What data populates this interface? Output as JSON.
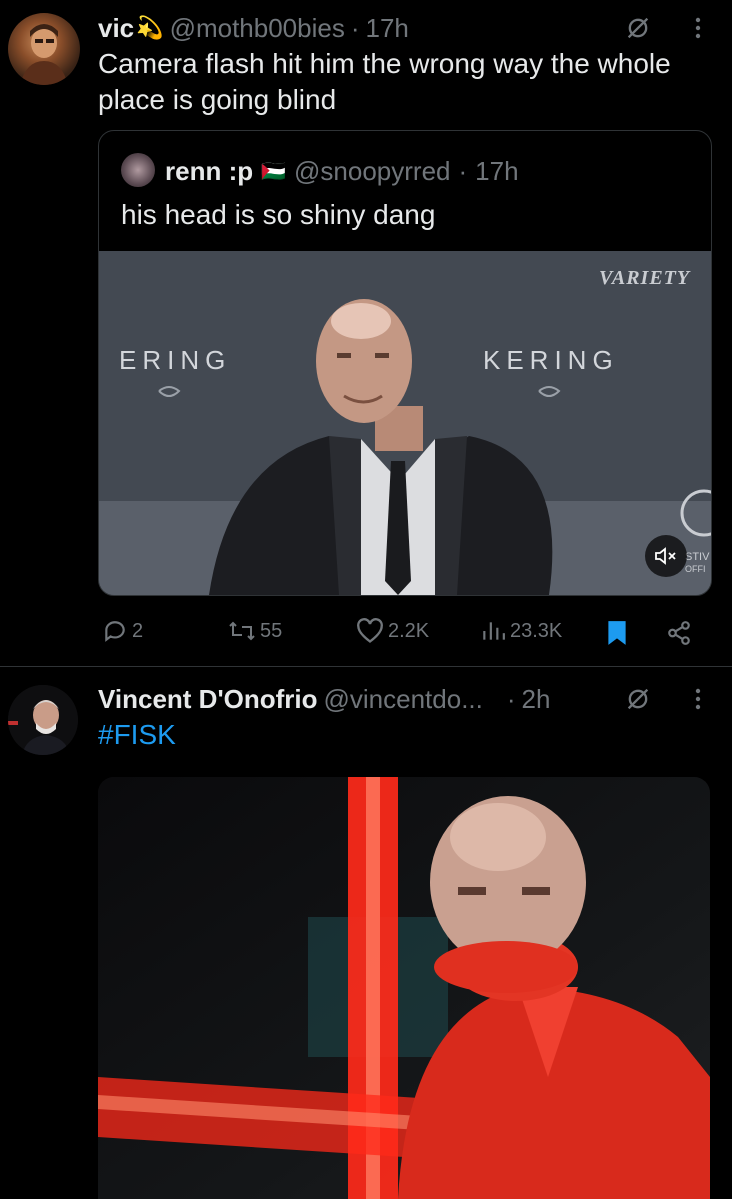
{
  "post1": {
    "author_name": "vic",
    "author_emoji": "💫",
    "handle": "@mothb00bies",
    "separator": "·",
    "time": "17h",
    "text": "Camera flash hit him the wrong way the whole place is going blind",
    "quote": {
      "author_name": "renn :p",
      "flag": "🇵🇸",
      "handle": "@snoopyrred",
      "separator": "·",
      "time": "17h",
      "text": "his head is so shiny dang",
      "media": {
        "brand_logo": "VARIETY",
        "backdrop_text_left": "ERING",
        "backdrop_text_right": "KERING",
        "corner_text": "STIV",
        "corner_text2": "OFFI"
      }
    },
    "actions": {
      "replies": "2",
      "reposts": "55",
      "likes": "2.2K",
      "views": "23.3K"
    }
  },
  "post2": {
    "author_name": "Vincent D'Onofrio",
    "handle": "@vincentdo...",
    "separator": "·",
    "time": "2h",
    "text": "#FISK"
  },
  "colors": {
    "background": "#000000",
    "text": "#e7e9ea",
    "muted": "#71767b",
    "accent": "#1d9bf0",
    "divider": "#2f3336"
  },
  "icons": [
    "mute-icon",
    "more-icon",
    "reply-icon",
    "repost-icon",
    "like-icon",
    "views-icon",
    "bookmark-icon",
    "share-icon",
    "volume-muted-icon"
  ]
}
